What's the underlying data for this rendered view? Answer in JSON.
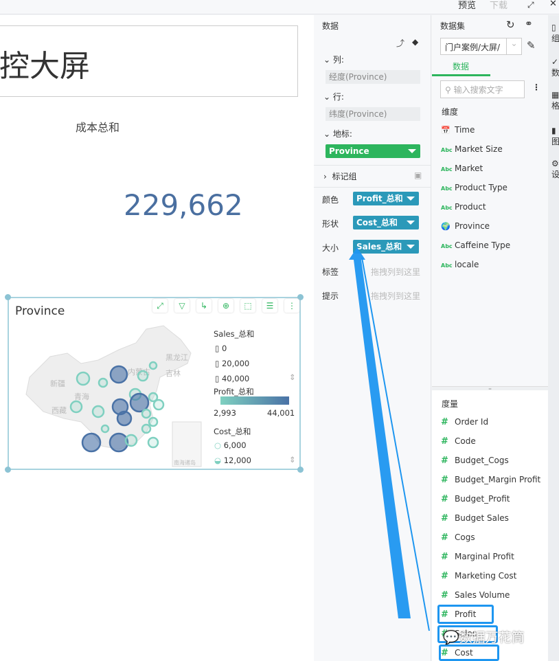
{
  "topbar": {
    "preview": "预览",
    "download": "下载"
  },
  "canvas": {
    "title": "控大屏",
    "kpi_label": "成本总和",
    "kpi_value": "229,662"
  },
  "map": {
    "title": "Province",
    "tools": [
      "expand-icon",
      "filter-icon",
      "drill-icon",
      "zoom-in-icon",
      "select-icon",
      "list-icon",
      "more-icon"
    ],
    "region_labels": [
      "新疆",
      "西藏",
      "青海",
      "内蒙古",
      "黑龙江",
      "吉林",
      "南海诸岛"
    ],
    "legend": {
      "sales_title": "Sales_总和",
      "sales_items": [
        "0",
        "20,000",
        "40,000"
      ],
      "profit_title": "Profit_总和",
      "profit_min": "2,993",
      "profit_max": "44,001",
      "profit_colors": [
        "#7fd0c0",
        "#4a72a6"
      ],
      "cost_title": "Cost_总和",
      "cost_items": [
        "6,000",
        "12,000"
      ]
    }
  },
  "data_panel": {
    "title": "数据",
    "columns_label": "列:",
    "columns_value": "经度(Province)",
    "rows_label": "行:",
    "rows_value": "纬度(Province)",
    "marker_label": "地标:",
    "marker_value": "Province",
    "markgroup_label": "标记组",
    "color_label": "颜色",
    "color_value": "Profit_总和",
    "shape_label": "形状",
    "shape_value": "Cost_总和",
    "size_label": "大小",
    "size_value": "Sales_总和",
    "tag_label": "标签",
    "tip_label": "提示",
    "drop_hint": "拖拽列到这里"
  },
  "dataset_panel": {
    "title": "数据集",
    "dataset_value": "门户案例/大屏/",
    "tab": "数据",
    "search_placeholder": "输入搜索文字",
    "dimensions_title": "维度",
    "dimensions": [
      {
        "icon": "calendar-icon",
        "label": "Time"
      },
      {
        "icon": "abc-icon",
        "label": "Market Size"
      },
      {
        "icon": "abc-icon",
        "label": "Market"
      },
      {
        "icon": "abc-icon",
        "label": "Product Type"
      },
      {
        "icon": "abc-icon",
        "label": "Product"
      },
      {
        "icon": "globe-icon",
        "label": "Province"
      },
      {
        "icon": "abc-icon",
        "label": "Caffeine Type"
      },
      {
        "icon": "abc-icon",
        "label": "locale"
      }
    ],
    "measures_title": "度量",
    "measures": [
      "Order Id",
      "Code",
      "Budget_Cogs",
      "Budget_Margin Profit",
      "Budget_Profit",
      "Budget Sales",
      "Cogs",
      "Marginal Profit",
      "Marketing Cost",
      "Sales Volume",
      "Profit",
      "Sales",
      "Cost"
    ]
  },
  "side_tabs": [
    "组",
    "数",
    "格",
    "图",
    "设"
  ],
  "watermark": "数据万花筒",
  "accent": "#2db55d",
  "pill_color": "#2b99b9",
  "highlight_color": "#1e96f0"
}
